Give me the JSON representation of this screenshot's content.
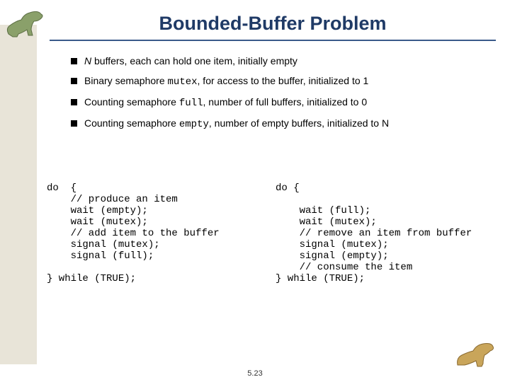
{
  "title": "Bounded-Buffer Problem",
  "bullets": {
    "b1": {
      "pre": "",
      "ital": "N",
      "post": " buffers, each can hold one item, initially empty"
    },
    "b2": {
      "pre": "Binary semaphore ",
      "code": "mutex",
      "post": ", for access to the buffer, initialized to 1"
    },
    "b3": {
      "pre": "Counting semaphore ",
      "code": "full",
      "post": ", number of full buffers, initialized to 0"
    },
    "b4": {
      "pre": "Counting semaphore ",
      "code": "empty",
      "post": ", number of empty buffers, initialized to N"
    }
  },
  "code": {
    "left": "do  {\n    // produce an item\n    wait (empty);\n    wait (mutex);\n    // add item to the buffer\n    signal (mutex);\n    signal (full);\n\n} while (TRUE);",
    "right": "do {\n\n    wait (full);\n    wait (mutex);\n    // remove an item from buffer\n    signal (mutex);\n    signal (empty);\n    // consume the item\n} while (TRUE);"
  },
  "pagenum": "5.23"
}
